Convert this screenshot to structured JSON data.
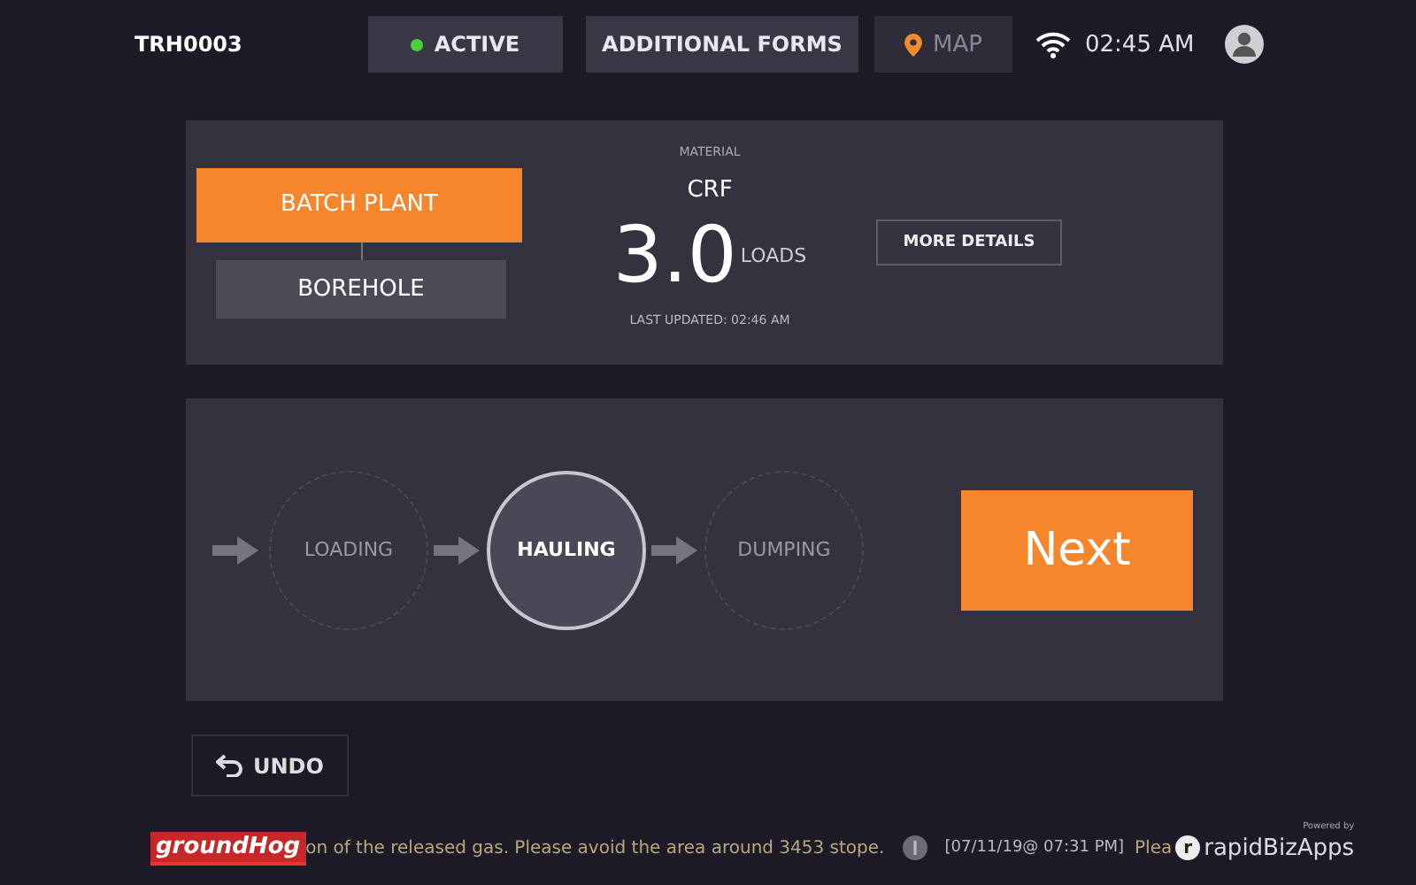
{
  "header": {
    "truck_id": "TRH0003",
    "status": {
      "label": "ACTIVE",
      "color": "#4cd137"
    },
    "forms_button": "ADDITIONAL FORMS",
    "map_button": "MAP",
    "time": "02:45 AM"
  },
  "material_panel": {
    "sources": [
      {
        "label": "BATCH PLANT",
        "selected": true
      },
      {
        "label": "BOREHOLE",
        "selected": false
      }
    ],
    "material_label": "MATERIAL",
    "material": "CRF",
    "count": "3.0",
    "count_unit": "LOADS",
    "last_updated": "LAST UPDATED: 02:46 AM",
    "details_button": "MORE DETAILS"
  },
  "steps": [
    {
      "label": "LOADING",
      "selected": false
    },
    {
      "label": "HAULING",
      "selected": true
    },
    {
      "label": "DUMPING",
      "selected": false
    }
  ],
  "next_button": "Next",
  "undo_button": "UNDO",
  "footer": {
    "logo": "groundHog",
    "ticker": "on of the released gas. Please avoid the area around 3453 stope.",
    "timestamp": "[07/11/19@ 07:31 PM]",
    "ticker_2": "Plea",
    "brand_tagline": "Powered by",
    "brand_mark": "r",
    "brand": "rapidBizApps"
  }
}
